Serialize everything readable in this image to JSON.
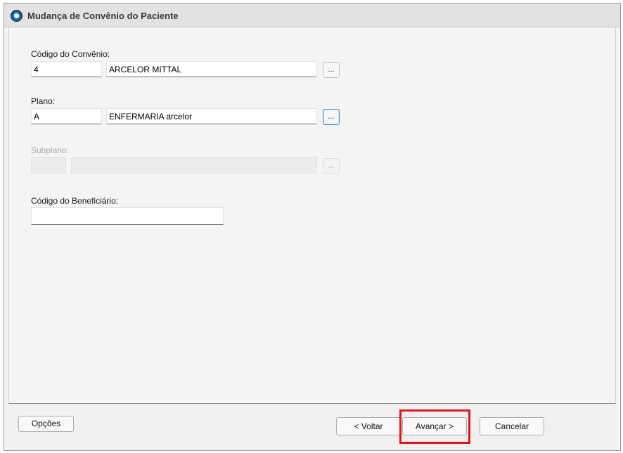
{
  "window": {
    "title": "Mudança de Convênio do Paciente",
    "icon": "app-logo-icon"
  },
  "form": {
    "convenio": {
      "label": "Código do Convênio:",
      "code": "4",
      "name": "ARCELOR MITTAL",
      "lookup_label": "..."
    },
    "plano": {
      "label": "Plano:",
      "code": "A",
      "name": "ENFERMARIA arcelor",
      "lookup_label": "..."
    },
    "subplano": {
      "label": "Subplano:",
      "code": "",
      "name": "",
      "lookup_label": "...",
      "enabled": false
    },
    "beneficiario": {
      "label": "Código do Beneficiário:",
      "value": ""
    }
  },
  "footer": {
    "options_label": "Opções",
    "back_label": "< Voltar",
    "next_label": "Avançar >",
    "cancel_label": "Cancelar"
  },
  "colors": {
    "highlight": "#e0161c",
    "focus": "#3c8fd6"
  }
}
